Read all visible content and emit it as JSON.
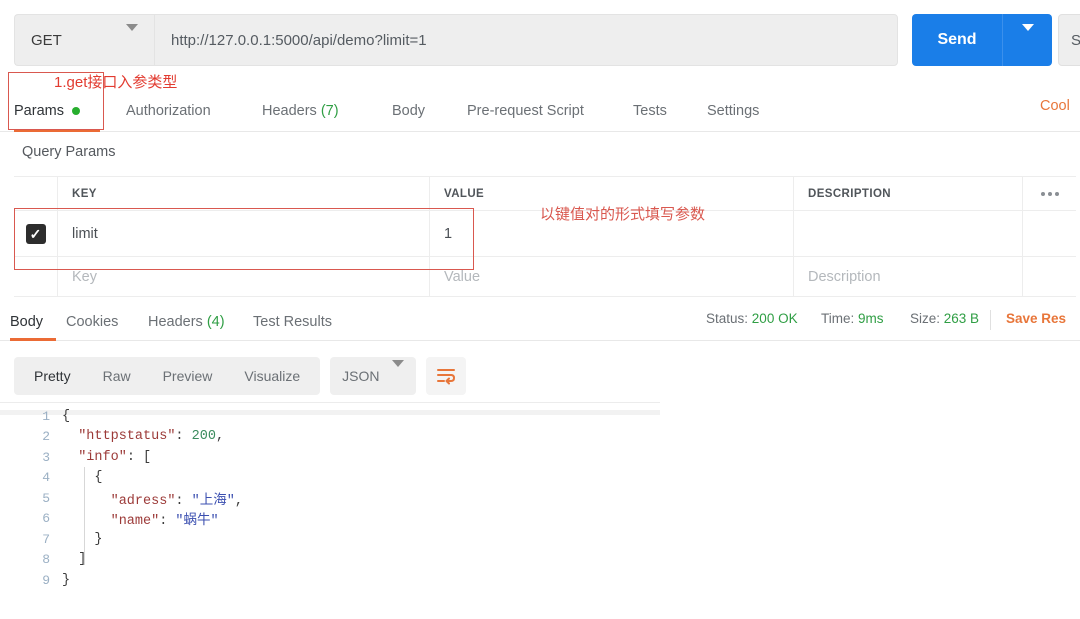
{
  "request": {
    "method": "GET",
    "url": "http://127.0.0.1:5000/api/demo?limit=1",
    "send_label": "Send",
    "save_label": "Sa",
    "cookies_link": "Cool",
    "tabs": [
      {
        "label": "Params",
        "has_dot": true
      },
      {
        "label": "Authorization"
      },
      {
        "label": "Headers",
        "count": "(7)"
      },
      {
        "label": "Body"
      },
      {
        "label": "Pre-request Script"
      },
      {
        "label": "Tests"
      },
      {
        "label": "Settings"
      }
    ]
  },
  "query_params": {
    "section_title": "Query Params",
    "columns": [
      "KEY",
      "VALUE",
      "DESCRIPTION"
    ],
    "rows": [
      {
        "checked": true,
        "key": "limit",
        "value": "1",
        "description": ""
      }
    ],
    "placeholder_row": {
      "key": "Key",
      "value": "Value",
      "description": "Description"
    }
  },
  "response": {
    "tabs": [
      {
        "label": "Body"
      },
      {
        "label": "Cookies"
      },
      {
        "label": "Headers",
        "count": "(4)"
      },
      {
        "label": "Test Results"
      }
    ],
    "status_label": "Status:",
    "status_value": "200 OK",
    "time_label": "Time:",
    "time_value": "9ms",
    "size_label": "Size:",
    "size_value": "263 B",
    "save_response": "Save Res",
    "view_modes": [
      "Pretty",
      "Raw",
      "Preview",
      "Visualize"
    ],
    "format": "JSON",
    "code_lines": [
      {
        "n": "1",
        "parts": [
          {
            "t": "{",
            "c": "jpunc"
          }
        ]
      },
      {
        "n": "2",
        "parts": [
          {
            "t": "  \"httpstatus\"",
            "c": "jkey"
          },
          {
            "t": ": ",
            "c": "jpunc"
          },
          {
            "t": "200",
            "c": "jnum"
          },
          {
            "t": ",",
            "c": "jpunc"
          }
        ]
      },
      {
        "n": "3",
        "parts": [
          {
            "t": "  \"info\"",
            "c": "jkey"
          },
          {
            "t": ": [",
            "c": "jpunc"
          }
        ]
      },
      {
        "n": "4",
        "parts": [
          {
            "t": "    {",
            "c": "jpunc"
          }
        ]
      },
      {
        "n": "5",
        "parts": [
          {
            "t": "      \"adress\"",
            "c": "jkey"
          },
          {
            "t": ": ",
            "c": "jpunc"
          },
          {
            "t": "\"上海\"",
            "c": "jstr"
          },
          {
            "t": ",",
            "c": "jpunc"
          }
        ]
      },
      {
        "n": "6",
        "parts": [
          {
            "t": "      \"name\"",
            "c": "jkey"
          },
          {
            "t": ": ",
            "c": "jpunc"
          },
          {
            "t": "\"蜗牛\"",
            "c": "jstr"
          }
        ]
      },
      {
        "n": "7",
        "parts": [
          {
            "t": "    }",
            "c": "jpunc"
          }
        ]
      },
      {
        "n": "8",
        "parts": [
          {
            "t": "  ]",
            "c": "jpunc"
          }
        ]
      },
      {
        "n": "9",
        "parts": [
          {
            "t": "}",
            "c": "jpunc"
          }
        ]
      }
    ]
  },
  "annotations": {
    "params_note": "1.get接口入参类型",
    "keyvalue_note": "以键值对的形式填写参数"
  },
  "colors": {
    "accent_orange": "#eb6b35",
    "send_blue": "#1a7ee8",
    "status_green": "#2f9e44",
    "annotation_red": "#d9584f"
  }
}
